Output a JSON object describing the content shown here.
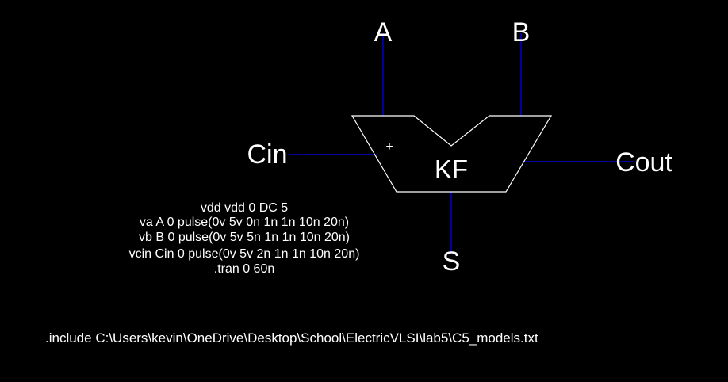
{
  "colors": {
    "background": "#000000",
    "wire": "#0000ff",
    "outline": "#ffffff",
    "text": "#ffffff"
  },
  "pins": {
    "a": "A",
    "b": "B",
    "cin": "Cin",
    "cout": "Cout",
    "s": "S"
  },
  "block": {
    "name": "KF",
    "marker": "+"
  },
  "spice": {
    "lines": [
      "vdd vdd 0 DC 5",
      "va A 0 pulse(0v 5v 0n 1n 1n 10n 20n)",
      "vb B 0 pulse(0v 5v 5n 1n 1n 10n 20n)",
      "vcin Cin 0 pulse(0v 5v 2n 1n 1n 10n 20n)",
      ".tran 0 60n"
    ],
    "include": ".include C:\\Users\\kevin\\OneDrive\\Desktop\\School\\ElectricVLSI\\lab5\\C5_models.txt"
  }
}
